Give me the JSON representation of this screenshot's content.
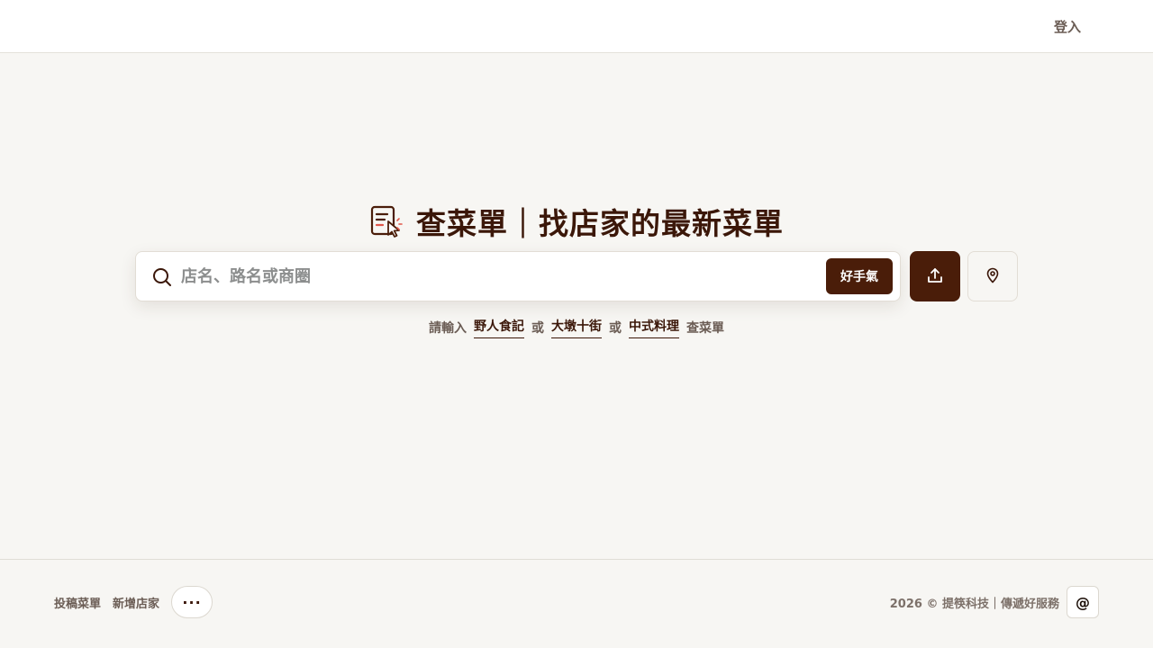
{
  "header": {
    "login_label": "登入"
  },
  "hero": {
    "title": "查菜單｜找店家的最新菜單",
    "logo_icon": "menu-cursor-icon"
  },
  "search": {
    "placeholder": "店名、路名或商圈",
    "value": "",
    "lucky_label": "好手氣",
    "search_icon": "search-icon",
    "upload_icon": "upload-icon",
    "location_icon": "map-pin-icon"
  },
  "hint": {
    "prefix": "請輸入",
    "examples": [
      "野人食記",
      "大墩十街",
      "中式料理"
    ],
    "separator": "或",
    "suffix": "查菜單"
  },
  "footer": {
    "links": [
      "投稿菜單",
      "新增店家"
    ],
    "more_label": "···",
    "copyright": "2026 © 提筷科技｜傳遞好服務",
    "contact_label": "@"
  },
  "colors": {
    "brand": "#4a1d09",
    "background": "#f7f6f3",
    "accent_red": "#e0564a"
  }
}
